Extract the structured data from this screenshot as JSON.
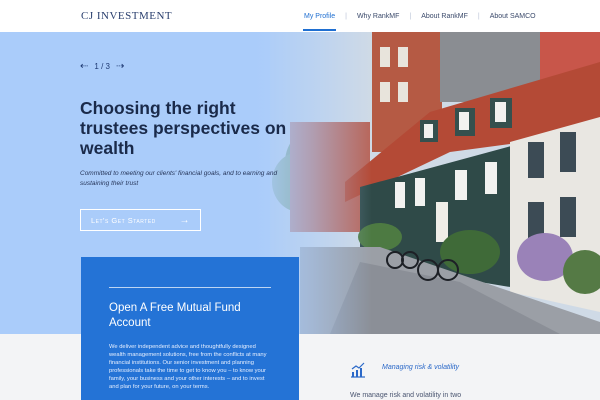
{
  "nav": {
    "logo": "CJ INVESTMENT",
    "items": [
      {
        "label": "My Profile",
        "active": true
      },
      {
        "label": "Why RankMF",
        "active": false
      },
      {
        "label": "About RankMF",
        "active": false
      },
      {
        "label": "About SAMCO",
        "active": false
      }
    ],
    "separator": "|"
  },
  "hero": {
    "slider": {
      "prev_icon": "arrow-left-icon",
      "counter": "1 / 3",
      "next_icon": "arrow-right-icon"
    },
    "headline": "Choosing the right trustees perspectives on wealth",
    "tagline": "Committed to meeting our clients' financial goals, and to earning and sustaining their trust",
    "cta_label": "Let's Get Started",
    "cta_icon": "arrow-right-icon"
  },
  "card": {
    "title": "Open A Free Mutual Fund Account",
    "body": "We deliver independent advice and thoughtfully designed wealth management solutions, free from the conflicts at many financial institutions. Our senior investment and planning professionals take the time to get to know you – to know your family, your business and your other interests – and to invest and plan for your future, on your terms."
  },
  "feature": {
    "icon": "chart-icon",
    "title": "Managing risk & volatility",
    "text": "We manage risk and volatility in two"
  },
  "colors": {
    "accent": "#1f6fd1",
    "card": "#2473d6",
    "hero_blue": "#a9cdfb",
    "heading": "#1a2a4a"
  }
}
